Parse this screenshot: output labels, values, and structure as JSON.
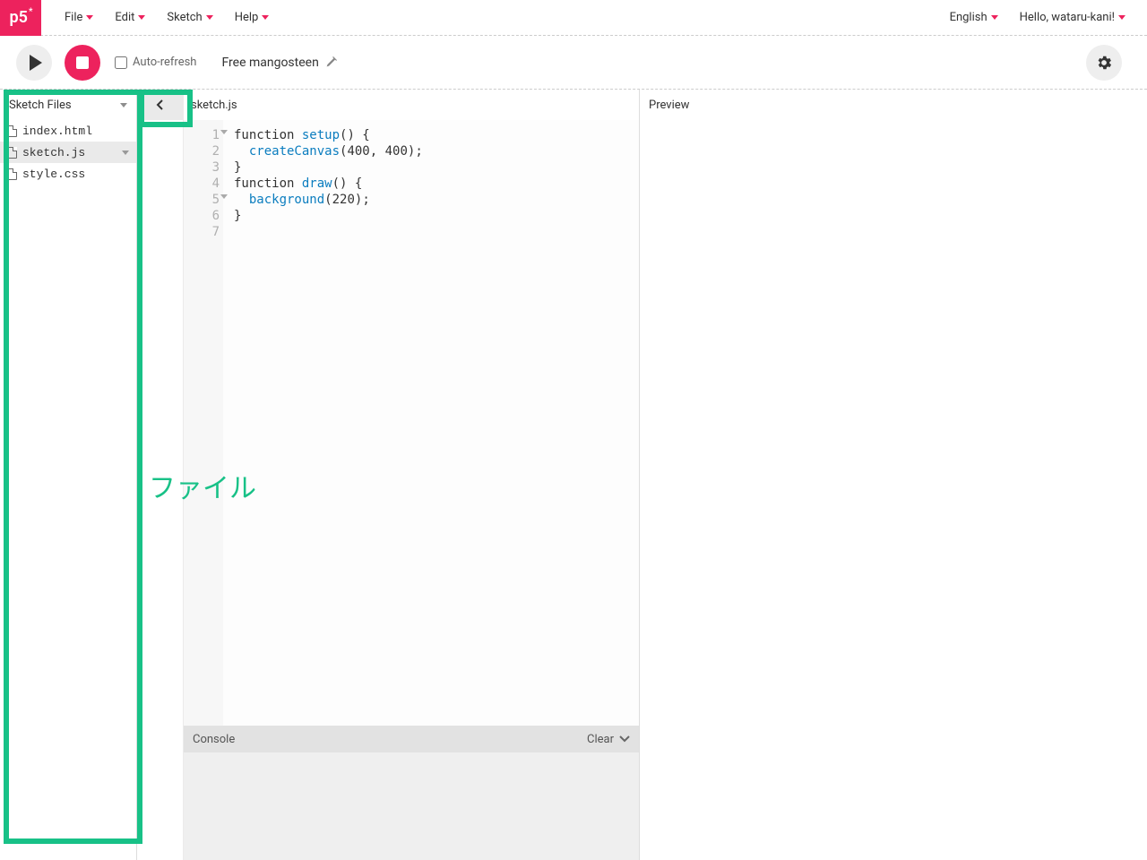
{
  "topbar": {
    "logo": "p5",
    "menus": [
      "File",
      "Edit",
      "Sketch",
      "Help"
    ],
    "language": "English",
    "greeting": "Hello, wataru-kani!"
  },
  "toolbar": {
    "autorefresh_label": "Auto-refresh",
    "sketch_name": "Free mangosteen"
  },
  "sidebar": {
    "title": "Sketch Files",
    "files": [
      {
        "name": "index.html",
        "selected": false
      },
      {
        "name": "sketch.js",
        "selected": true
      },
      {
        "name": "style.css",
        "selected": false
      }
    ]
  },
  "editor": {
    "tab": "sketch.js",
    "lines": [
      {
        "n": 1,
        "fold": true
      },
      {
        "n": 2,
        "fold": false
      },
      {
        "n": 3,
        "fold": false
      },
      {
        "n": 4,
        "fold": false
      },
      {
        "n": 5,
        "fold": true
      },
      {
        "n": 6,
        "fold": false
      },
      {
        "n": 7,
        "fold": false
      }
    ],
    "code_tokens": [
      [
        {
          "t": "function ",
          "c": ""
        },
        {
          "t": "setup",
          "c": "kw"
        },
        {
          "t": "() {",
          "c": ""
        }
      ],
      [
        {
          "t": "  ",
          "c": ""
        },
        {
          "t": "createCanvas",
          "c": "kw"
        },
        {
          "t": "(",
          "c": ""
        },
        {
          "t": "400",
          "c": "num"
        },
        {
          "t": ", ",
          "c": ""
        },
        {
          "t": "400",
          "c": "num"
        },
        {
          "t": ");",
          "c": ""
        }
      ],
      [
        {
          "t": "}",
          "c": ""
        }
      ],
      [
        {
          "t": "",
          "c": ""
        }
      ],
      [
        {
          "t": "function ",
          "c": ""
        },
        {
          "t": "draw",
          "c": "kw"
        },
        {
          "t": "() {",
          "c": ""
        }
      ],
      [
        {
          "t": "  ",
          "c": ""
        },
        {
          "t": "background",
          "c": "kw"
        },
        {
          "t": "(",
          "c": ""
        },
        {
          "t": "220",
          "c": "num"
        },
        {
          "t": ");",
          "c": ""
        }
      ],
      [
        {
          "t": "}",
          "c": ""
        }
      ]
    ]
  },
  "console": {
    "title": "Console",
    "clear": "Clear"
  },
  "preview": {
    "title": "Preview"
  },
  "annotation": "ファイル"
}
